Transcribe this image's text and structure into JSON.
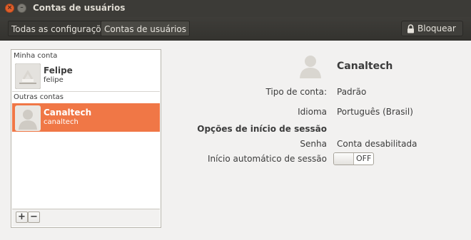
{
  "window": {
    "title": "Contas de usuários"
  },
  "toolbar": {
    "breadcrumbs": [
      "Todas as configurações",
      "Contas de usuários"
    ],
    "lock_label": "Bloquear"
  },
  "accounts": {
    "my_account_header": "Minha conta",
    "other_accounts_header": "Outras contas",
    "my_account": {
      "name": "Felipe",
      "username": "felipe"
    },
    "others": [
      {
        "name": "Canaltech",
        "username": "canaltech",
        "selected": true
      }
    ]
  },
  "details": {
    "name": "Canaltech",
    "account_type_label": "Tipo de conta:",
    "account_type_value": "Padrão",
    "language_label": "Idioma",
    "language_value": "Português (Brasil)",
    "login_options_header": "Opções de início de sessão",
    "password_label": "Senha",
    "password_value": "Conta desabilitada",
    "autologin_label": "Início automático de sessão",
    "autologin_state": "OFF"
  },
  "colors": {
    "accent": "#f07746",
    "titlebar": "#3c3b37"
  },
  "icons": {
    "close": "close-icon",
    "minimize": "minimize-icon",
    "lock": "lock-icon",
    "add": "add-icon",
    "remove": "remove-icon",
    "avatar": "user-avatar-icon"
  }
}
